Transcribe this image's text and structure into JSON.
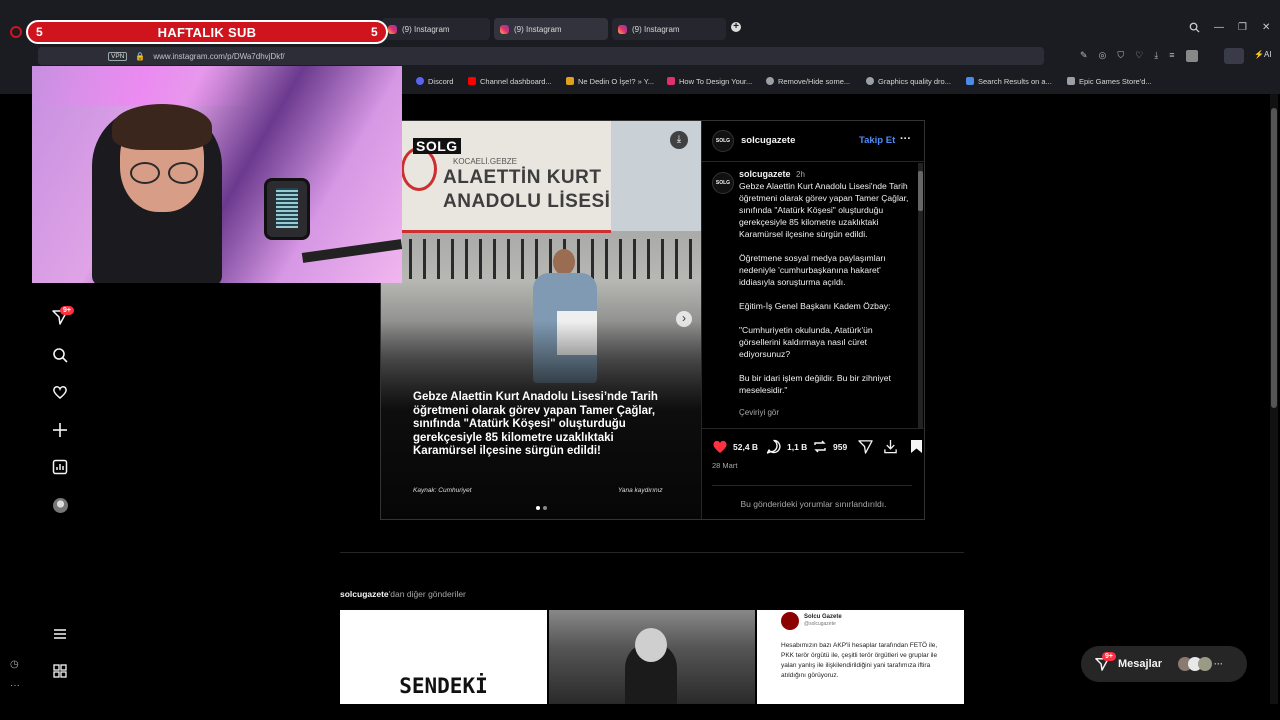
{
  "overlay": {
    "sub_title": "HAFTALIK SUB",
    "sub_left": "5",
    "sub_right": "5"
  },
  "browser": {
    "tabs": [
      {
        "label": "(9) Instagram"
      },
      {
        "label": "(9) Instagram"
      },
      {
        "label": "(9) Instagram"
      }
    ],
    "vpn_label": "VPN",
    "url": "www.instagram.com/p/DWa7dhvjDkf/",
    "ai_label": "AI",
    "bookmarks": [
      {
        "label": "Discord",
        "color": "#5865f2"
      },
      {
        "label": "Channel dashboard...",
        "color": "#ff0000"
      },
      {
        "label": "Ne Dedin O İşe!? » Y...",
        "color": "#e0a020"
      },
      {
        "label": "How To Design Your...",
        "color": "#e1306c"
      },
      {
        "label": "Remove/Hide some...",
        "color": "#9aa0a6"
      },
      {
        "label": "Graphics quality dro...",
        "color": "#9aa0a6"
      },
      {
        "label": "Search Results on a...",
        "color": "#4b8be8"
      },
      {
        "label": "Epic Games Store'd...",
        "color": "#9aa0a6"
      }
    ]
  },
  "nav": {
    "notif_badge": "9+"
  },
  "post": {
    "image": {
      "watermark": "SOLG",
      "sign_top": "KOCAELİ.GEBZE",
      "sign_line1": "ALAETTİN KURT",
      "sign_line2": "ANADOLU LİSESİ",
      "headline": "Gebze Alaettin Kurt Anadolu Lisesi’nde Tarih öğretmeni olarak görev yapan Tamer Çağlar, sınıfında \"Atatürk Köşesi\" oluşturduğu gerekçesiyle 85 kilometre uzaklıktaki Karamürsel ilçesine sürgün edildi!",
      "source": "Kaynak: Cumhuriyet",
      "slide_hint": "Yana kaydırınız"
    },
    "header": {
      "avatar_text": "SOLG",
      "username": "solcugazete",
      "follow": "Takip Et",
      "more": "···"
    },
    "caption": {
      "username": "solcugazete",
      "time": "2h",
      "paragraphs": [
        "Gebze Alaettin Kurt Anadolu Lisesi'nde Tarih öğretmeni olarak görev yapan Tamer Çağlar, sınıfında \"Atatürk Köşesi\" oluşturduğu gerekçesiyle 85 kilometre uzaklıktaki Karamürsel ilçesine sürgün edildi.",
        "Öğretmene sosyal medya paylaşımları nedeniyle 'cumhurbaşkanına hakaret' iddiasıyla soruşturma açıldı.",
        "Eğitim-İş Genel Başkanı Kadem Özbay:",
        "\"Cumhuriyetin okulunda, Atatürk'ün görsellerini kaldırmaya nasıl cüret ediyorsunuz?",
        "Bu bir idari işlem değildir. Bu bir zihniyet meselesidir.\""
      ],
      "see_translation": "Çeviriyi gör"
    },
    "actions": {
      "likes": "52,4 B",
      "comments": "1,1 B",
      "reposts": "959"
    },
    "date": "28 Mart",
    "comments_limited": "Bu gönderideki yorumlar sınırlandırıldı."
  },
  "more_posts": {
    "username": "solcugazete",
    "suffix": "'dan diğer gönderiler",
    "thumb1_text": "SENDEKİ",
    "thumb3": {
      "name": "Solcu Gazete",
      "handle": "@solcugazete",
      "text": "Hesabımızın bazı AKP'li hesaplar tarafından FETÖ ile, PKK terör örgütü ile, çeşitli terör örgütleri ve gruplar ile yalan yanlış ile ilişkilendirildiğini yani tarafımıza iftira atıldığını görüyoruz."
    }
  },
  "messages": {
    "label": "Mesajlar",
    "badge": "9+"
  }
}
